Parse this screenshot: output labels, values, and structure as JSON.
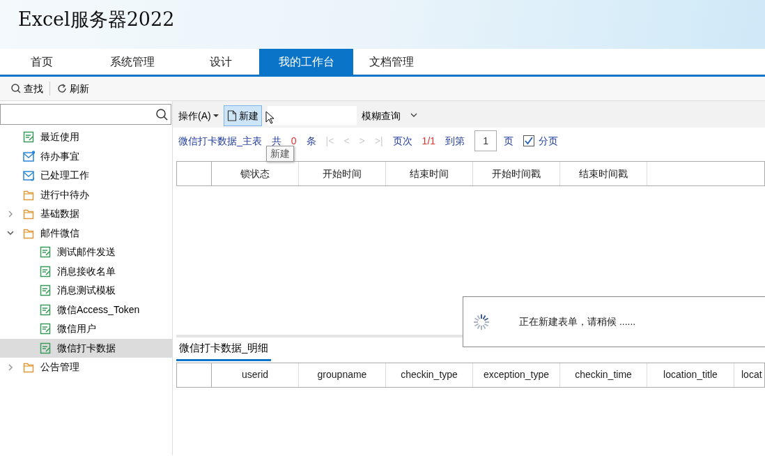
{
  "app_title": "Excel服务器2022",
  "tabs": [
    {
      "label": "首页",
      "selected": false
    },
    {
      "label": "系统管理",
      "selected": false
    },
    {
      "label": "设计",
      "selected": false
    },
    {
      "label": "我的工作台",
      "selected": true
    },
    {
      "label": "文档管理",
      "selected": false
    }
  ],
  "toolbar": [
    {
      "kind": "search",
      "label": "查找"
    },
    {
      "kind": "refresh",
      "label": "刷新"
    }
  ],
  "sidebar": {
    "items": [
      {
        "label": "最近使用",
        "kind": "form",
        "selected": false
      },
      {
        "label": "待办事宜",
        "kind": "inbox",
        "selected": false
      },
      {
        "label": "已处理工作",
        "kind": "done",
        "selected": false
      },
      {
        "label": "进行中待办",
        "kind": "folder",
        "selected": false
      },
      {
        "label": "基础数据",
        "kind": "folder",
        "selected": false,
        "expanded": false
      },
      {
        "label": "邮件微信",
        "kind": "folder",
        "selected": false,
        "expanded": true,
        "children": [
          {
            "label": "测试邮件发送",
            "kind": "form",
            "selected": false
          },
          {
            "label": "消息接收名单",
            "kind": "form",
            "selected": false
          },
          {
            "label": "消息测试模板",
            "kind": "form",
            "selected": false
          },
          {
            "label": "微信Access_Token",
            "kind": "form",
            "selected": false
          },
          {
            "label": "微信用户",
            "kind": "form",
            "selected": false
          },
          {
            "label": "微信打卡数据",
            "kind": "form",
            "selected": true
          }
        ]
      },
      {
        "label": "公告管理",
        "kind": "folder",
        "selected": false,
        "expanded": false
      }
    ]
  },
  "action_bar": {
    "menu": "操作(A)",
    "new_button": {
      "label": "新建",
      "hovered": true
    },
    "filter": "模糊查询"
  },
  "pager": {
    "title": "微信打卡数据_主表",
    "total_prefix": "共",
    "total": "0",
    "total_suffix": "条",
    "nav": [
      {
        "label": "|<",
        "disabled": true
      },
      {
        "label": "<",
        "disabled": true
      },
      {
        "label": ">",
        "disabled": true
      },
      {
        "label": ">|",
        "disabled": true
      }
    ],
    "page_label": "页次",
    "page": "1/1",
    "goto_label": "到第",
    "goto_value": "1",
    "goto_suffix": "页",
    "paging": {
      "label": "分页",
      "checked": true
    }
  },
  "tooltip": "新建",
  "main_table": {
    "columns": [
      "锁状态",
      "开始时间",
      "结束时间",
      "开始时间戳",
      "结束时间戳"
    ]
  },
  "loading_dialog": {
    "message": "正在新建表单，请稍候 ......"
  },
  "detail_tab": {
    "label": "微信打卡数据_明细",
    "selected": true
  },
  "detail_table": {
    "columns": [
      "userid",
      "groupname",
      "checkin_type",
      "exception_type",
      "checkin_time",
      "location_title",
      "locat"
    ]
  }
}
